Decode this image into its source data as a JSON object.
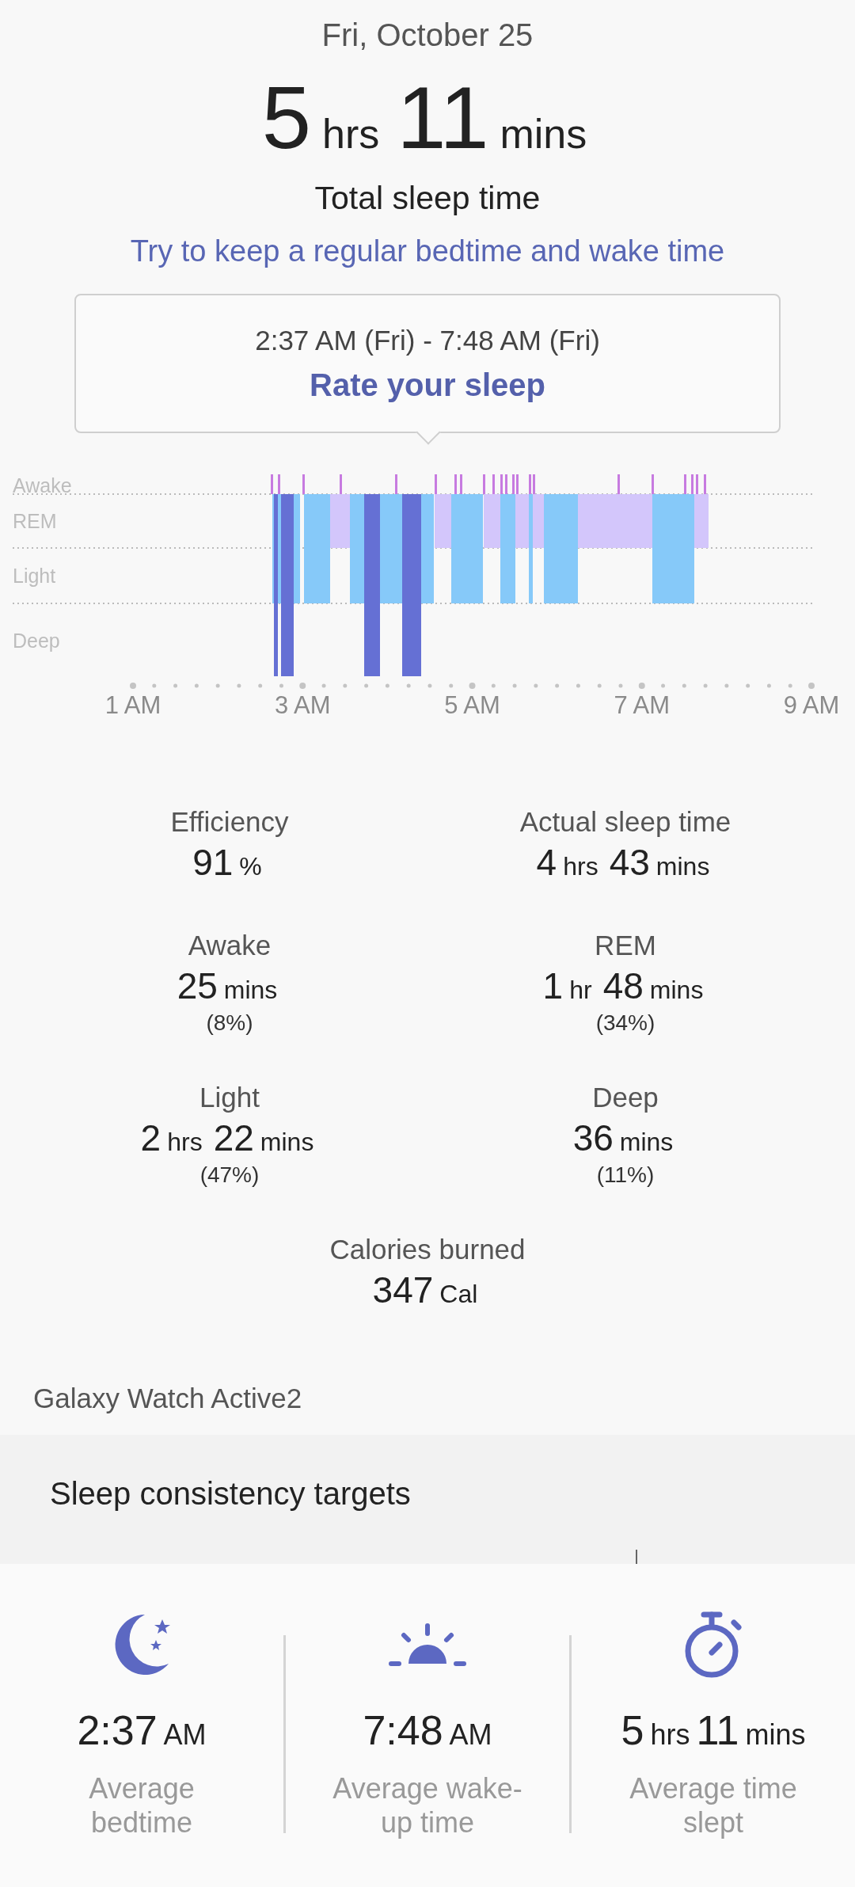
{
  "date": "Fri, October 25",
  "total": {
    "parts": [
      {
        "number": "5",
        "unit": "hrs"
      },
      {
        "number": "11",
        "unit": "mins"
      }
    ],
    "label": "Total sleep time"
  },
  "tip": "Try to keep a regular bedtime and wake time",
  "session_card": {
    "time_range": "2:37 AM (Fri) - 7:48 AM (Fri)",
    "action": "Rate your sleep"
  },
  "chart": {
    "stage_labels": [
      "Awake",
      "REM",
      "Light",
      "Deep"
    ],
    "time_labels": [
      "1 AM",
      "3 AM",
      "5 AM",
      "7 AM",
      "9 AM"
    ]
  },
  "stats": [
    {
      "label": "Efficiency",
      "parts": [
        {
          "number": "91",
          "unit": "%"
        }
      ]
    },
    {
      "label": "Actual sleep time",
      "parts": [
        {
          "number": "4",
          "unit": "hrs"
        },
        {
          "number": "43",
          "unit": "mins"
        }
      ]
    },
    {
      "label": "Awake",
      "parts": [
        {
          "number": "25",
          "unit": "mins"
        }
      ],
      "share": "(8%)"
    },
    {
      "label": "REM",
      "parts": [
        {
          "number": "1",
          "unit": "hr"
        },
        {
          "number": "48",
          "unit": "mins"
        }
      ],
      "share": "(34%)"
    },
    {
      "label": "Light",
      "parts": [
        {
          "number": "2",
          "unit": "hrs"
        },
        {
          "number": "22",
          "unit": "mins"
        }
      ],
      "share": "(47%)"
    },
    {
      "label": "Deep",
      "parts": [
        {
          "number": "36",
          "unit": "mins"
        }
      ],
      "share": "(11%)"
    },
    {
      "label": "Calories burned",
      "parts": [
        {
          "number": "347",
          "unit": "Cal"
        }
      ]
    }
  ],
  "device": "Galaxy Watch Active2",
  "consistency": {
    "title": "Sleep consistency targets"
  },
  "averages": [
    {
      "kind": "bedtime",
      "parts": [
        {
          "number": "2:37",
          "unit": "AM"
        }
      ],
      "label": "Average bedtime"
    },
    {
      "kind": "wake",
      "parts": [
        {
          "number": "7:48",
          "unit": "AM"
        }
      ],
      "label": "Average wake-up time"
    },
    {
      "kind": "duration",
      "parts": [
        {
          "number": "5",
          "unit": "hrs"
        },
        {
          "number": "11",
          "unit": "mins"
        }
      ],
      "label": "Average time slept"
    }
  ]
}
